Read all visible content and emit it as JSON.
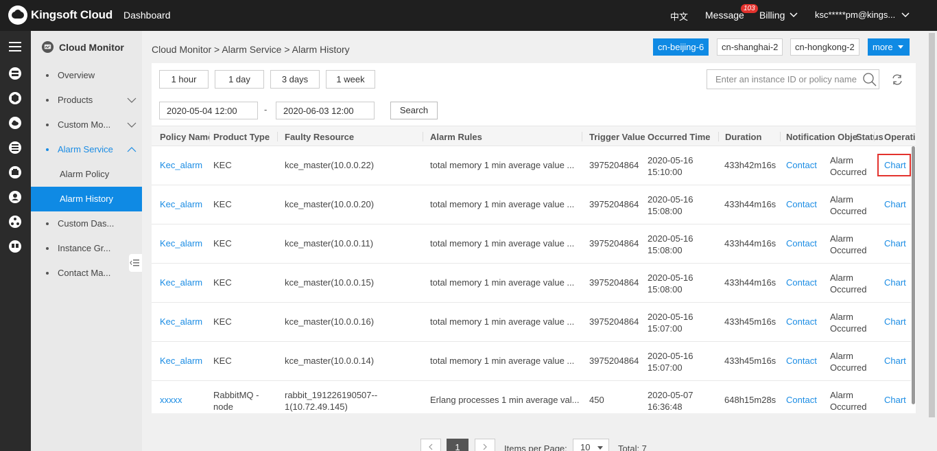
{
  "topbar": {
    "brand": "Kingsoft Cloud",
    "dashboard": "Dashboard",
    "language": "中文",
    "message": "Message",
    "message_count": "103",
    "billing": "Billing",
    "user": "ksc*****pm@kings..."
  },
  "sidebar": {
    "title": "Cloud Monitor",
    "items": [
      {
        "label": "Overview"
      },
      {
        "label": "Products"
      },
      {
        "label": "Custom Mo..."
      },
      {
        "label": "Alarm Service"
      },
      {
        "label": "Custom Das..."
      },
      {
        "label": "Instance Gr..."
      },
      {
        "label": "Contact Ma..."
      }
    ],
    "subitems": [
      {
        "label": "Alarm Policy"
      },
      {
        "label": "Alarm History"
      }
    ]
  },
  "breadcrumb": "Cloud Monitor > Alarm Service > Alarm History",
  "regions": [
    "cn-beijing-6",
    "cn-shanghai-2",
    "cn-hongkong-2"
  ],
  "regions_more": "more",
  "quick_ranges": [
    "1 hour",
    "1 day",
    "3 days",
    "1 week"
  ],
  "filter": {
    "start": "2020-05-04 12:00",
    "separator": "-",
    "end": "2020-06-03 12:00",
    "search_label": "Search",
    "search_placeholder": "Enter an instance ID or policy name"
  },
  "table": {
    "headers": [
      "Policy Name",
      "Product Type",
      "Faulty Resource",
      "Alarm Rules",
      "Trigger Value",
      "Occurred Time",
      "Duration",
      "Notification Object",
      "Status",
      "Operation"
    ],
    "rows": [
      {
        "policy": "Kec_alarm",
        "product": "KEC",
        "resource": "kce_master(10.0.0.22)",
        "rule": "total memory 1 min average value ...",
        "trigger": "3975204864",
        "time": "2020-05-16 15:10:00",
        "duration": "433h42m16s",
        "notify": "Contact",
        "status": "Alarm Occurred",
        "op": "Chart"
      },
      {
        "policy": "Kec_alarm",
        "product": "KEC",
        "resource": "kce_master(10.0.0.20)",
        "rule": "total memory 1 min average value ...",
        "trigger": "3975204864",
        "time": "2020-05-16 15:08:00",
        "duration": "433h44m16s",
        "notify": "Contact",
        "status": "Alarm Occurred",
        "op": "Chart"
      },
      {
        "policy": "Kec_alarm",
        "product": "KEC",
        "resource": "kce_master(10.0.0.11)",
        "rule": "total memory 1 min average value ...",
        "trigger": "3975204864",
        "time": "2020-05-16 15:08:00",
        "duration": "433h44m16s",
        "notify": "Contact",
        "status": "Alarm Occurred",
        "op": "Chart"
      },
      {
        "policy": "Kec_alarm",
        "product": "KEC",
        "resource": "kce_master(10.0.0.15)",
        "rule": "total memory 1 min average value ...",
        "trigger": "3975204864",
        "time": "2020-05-16 15:08:00",
        "duration": "433h44m16s",
        "notify": "Contact",
        "status": "Alarm Occurred",
        "op": "Chart"
      },
      {
        "policy": "Kec_alarm",
        "product": "KEC",
        "resource": "kce_master(10.0.0.16)",
        "rule": "total memory 1 min average value ...",
        "trigger": "3975204864",
        "time": "2020-05-16 15:07:00",
        "duration": "433h45m16s",
        "notify": "Contact",
        "status": "Alarm Occurred",
        "op": "Chart"
      },
      {
        "policy": "Kec_alarm",
        "product": "KEC",
        "resource": "kce_master(10.0.0.14)",
        "rule": "total memory 1 min average value ...",
        "trigger": "3975204864",
        "time": "2020-05-16 15:07:00",
        "duration": "433h45m16s",
        "notify": "Contact",
        "status": "Alarm Occurred",
        "op": "Chart"
      },
      {
        "policy": "xxxxx",
        "product": "RabbitMQ - node",
        "resource": "rabbit_191226190507--1(10.72.49.145)",
        "rule": "Erlang processes 1 min average val...",
        "trigger": "450",
        "time": "2020-05-07 16:36:48",
        "duration": "648h15m28s",
        "notify": "Contact",
        "status": "Alarm Occurred",
        "op": "Chart"
      }
    ]
  },
  "pagination": {
    "current": "1",
    "items_per_page_label": "Items per Page:",
    "page_size": "10",
    "total": "Total: 7"
  },
  "colors": {
    "accent": "#0f8ae4",
    "link": "#1a8ce4",
    "highlight": "#e3322d"
  }
}
